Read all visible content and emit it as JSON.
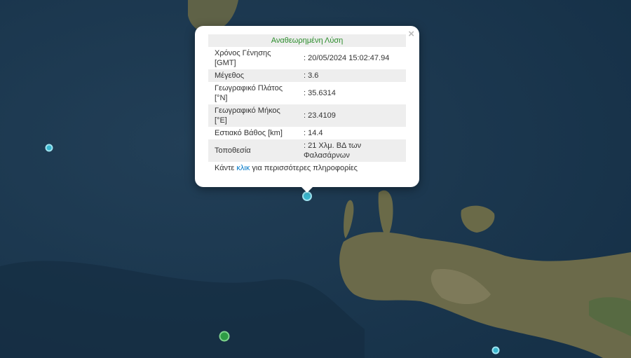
{
  "popup": {
    "title": "Αναθεωρημένη Λύση",
    "close_label": "×",
    "rows": [
      {
        "label": "Χρόνος Γένησης [GMT]",
        "value": ": 20/05/2024 15:02:47.94"
      },
      {
        "label": "Μέγεθος",
        "value": ": 3.6"
      },
      {
        "label": "Γεωγραφικό Πλάτος [°N]",
        "value": ": 35.6314"
      },
      {
        "label": "Γεωγραφικό Μήκος [°E]",
        "value": ": 23.4109"
      },
      {
        "label": "Εστιακό Βάθος [km]",
        "value": ": 14.4"
      },
      {
        "label": "Τοποθεσία",
        "value": ": 21 Χλμ. ΒΔ των Φαλασάρνων"
      }
    ],
    "footer_before": "Κάντε ",
    "footer_link": "κλικ",
    "footer_after": " για περισσότερες πληροφορίες"
  },
  "colors": {
    "sea": "#1b3a52",
    "land": "#6b6a4a",
    "marker_cyan": "#3ab7cf",
    "marker_green": "#2e9c45"
  },
  "markers": [
    "selected-earthquake",
    "earthquake-west",
    "earthquake-south",
    "earthquake-southeast"
  ]
}
